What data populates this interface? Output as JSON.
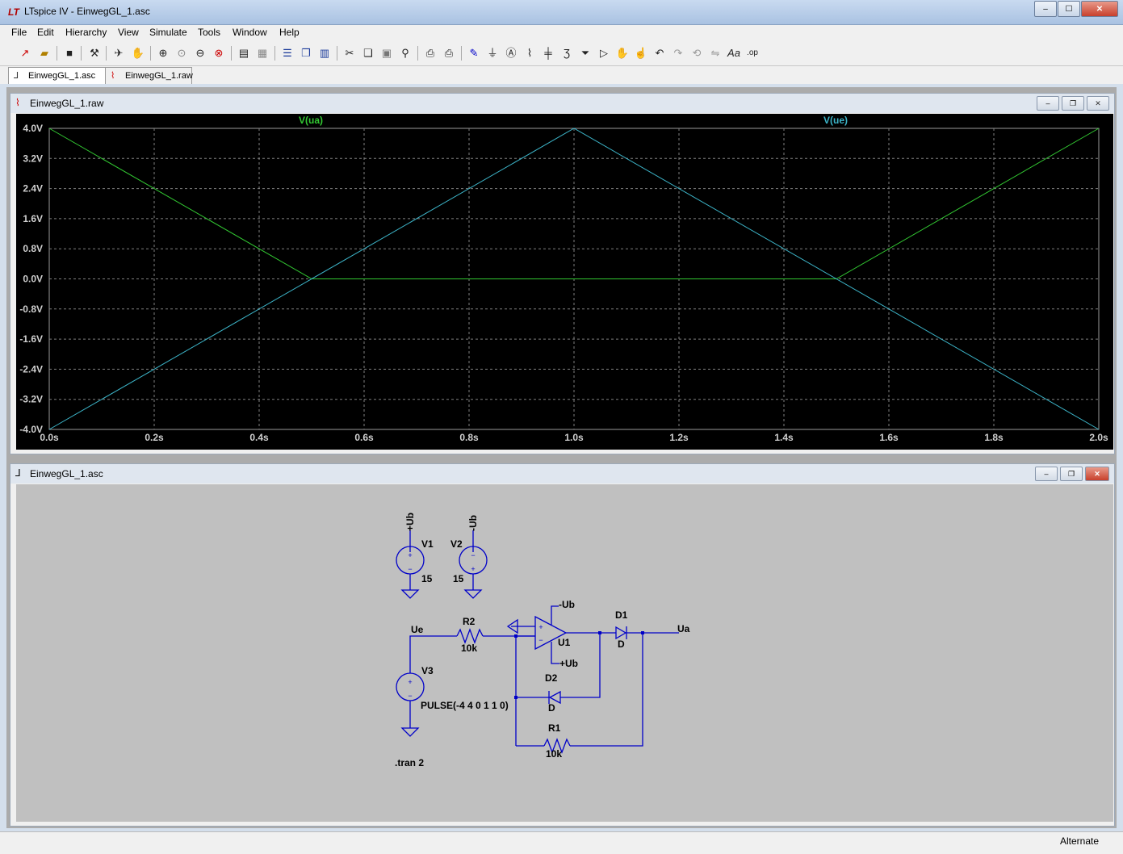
{
  "window": {
    "title": "LTspice IV - EinwegGL_1.asc",
    "app_icon": "LT",
    "min": "–",
    "max": "☐",
    "close": "✕"
  },
  "menu": [
    "File",
    "Edit",
    "Hierarchy",
    "View",
    "Simulate",
    "Tools",
    "Window",
    "Help"
  ],
  "toolbar_icons": [
    "new-schematic-icon",
    "open-icon",
    "save-icon",
    "control-panel-icon",
    "run-icon",
    "halt-icon",
    "zoom-in-icon",
    "zoom-full-icon",
    "zoom-out-icon",
    "zoom-cancel-icon",
    "autorange-icon",
    "grid-icon",
    "tile-horizontal-icon",
    "cascade-icon",
    "tile-vertical-icon",
    "cut-icon",
    "copy-icon",
    "paste-icon",
    "find-icon",
    "print-preview-icon",
    "print-icon",
    "draw-wire-icon",
    "ground-icon",
    "label-icon",
    "resistor-icon",
    "capacitor-icon",
    "inductor-icon",
    "diode-icon",
    "component-icon",
    "move-icon",
    "drag-icon",
    "undo-icon",
    "redo-icon",
    "rotate-icon",
    "mirror-icon",
    "text-icon",
    "spice-directive-icon"
  ],
  "tabs": [
    {
      "label": "EinwegGL_1.asc",
      "icon": "schematic-icon"
    },
    {
      "label": "EinwegGL_1.raw",
      "icon": "waveform-icon"
    }
  ],
  "plot_window": {
    "title": "EinwegGL_1.raw",
    "icon": "waveform-icon"
  },
  "schematic_window": {
    "title": "EinwegGL_1.asc",
    "icon": "schematic-icon"
  },
  "chart_data": {
    "type": "line",
    "title": "",
    "xlabel": "",
    "ylabel": "",
    "xlim": [
      0,
      2
    ],
    "ylim": [
      -4,
      4
    ],
    "grid": true,
    "x_ticks": [
      "0.0s",
      "0.2s",
      "0.4s",
      "0.6s",
      "0.8s",
      "1.0s",
      "1.2s",
      "1.4s",
      "1.6s",
      "1.8s",
      "2.0s"
    ],
    "y_ticks": [
      "4.0V",
      "3.2V",
      "2.4V",
      "1.6V",
      "0.8V",
      "0.0V",
      "-0.8V",
      "-1.6V",
      "-2.4V",
      "-3.2V",
      "-4.0V"
    ],
    "series": [
      {
        "name": "V(ua)",
        "color": "#32c832",
        "x": [
          0,
          0.5,
          1.5,
          2.0
        ],
        "y": [
          4,
          0,
          0,
          4
        ]
      },
      {
        "name": "V(ue)",
        "color": "#3cb4c8",
        "x": [
          0,
          1.0,
          2.0
        ],
        "y": [
          -4,
          4,
          -4
        ]
      }
    ]
  },
  "schematic": {
    "labels": {
      "ub_pos": "+Ub",
      "ub_neg": "-Ub",
      "v1": "V1",
      "v1_val": "15",
      "v2": "V2",
      "v2_val": "15",
      "v3": "V3",
      "v3_val": "PULSE(-4 4 0 1 1 0)",
      "ue": "Ue",
      "ua": "Ua",
      "r2": "R2",
      "r2_val": "10k",
      "r1": "R1",
      "r1_val": "10k",
      "d1": "D1",
      "d1_val": "D",
      "d2": "D2",
      "d2_val": "D",
      "u1": "U1",
      "opamp_neg": "-Ub",
      "opamp_pos": "+Ub",
      "directive": ".tran 2"
    },
    "wire_color": "#0000c8"
  },
  "status": {
    "text": "Alternate"
  }
}
